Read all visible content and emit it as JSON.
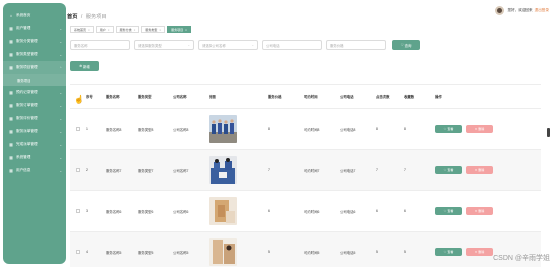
{
  "sidebar": {
    "items": [
      {
        "label": "系统首页",
        "icon": "home-icon"
      },
      {
        "label": "用户管理",
        "icon": "grid-icon",
        "expandable": true
      },
      {
        "label": "服务分类管理",
        "icon": "grid-icon",
        "expandable": true
      },
      {
        "label": "服务类型管理",
        "icon": "grid-icon",
        "expandable": true
      },
      {
        "label": "服务项目管理",
        "icon": "grid-icon",
        "expandable": true,
        "active": true,
        "sub": [
          "服务项目"
        ]
      },
      {
        "label": "预约记录管理",
        "icon": "grid-icon",
        "expandable": true
      },
      {
        "label": "服务订单管理",
        "icon": "grid-icon",
        "expandable": true
      },
      {
        "label": "服务评价管理",
        "icon": "grid-icon",
        "expandable": true
      },
      {
        "label": "服务派单管理",
        "icon": "grid-icon",
        "expandable": true
      },
      {
        "label": "完成派单管理",
        "icon": "grid-icon",
        "expandable": true
      },
      {
        "label": "系统管理",
        "icon": "grid-icon",
        "expandable": true
      },
      {
        "label": "用户信息",
        "icon": "grid-icon",
        "expandable": true
      }
    ]
  },
  "header": {
    "breadcrumb_home": "首页",
    "breadcrumb_sep": "/",
    "breadcrumb_current": "服务项目",
    "user_text": "您好，欢迎回来",
    "logout": "退出登录"
  },
  "tags": [
    "系统首页",
    "用户",
    "服务分类",
    "服务类型",
    "服务项目"
  ],
  "filters": {
    "name_placeholder": "服务名称",
    "type_placeholder": "请选择服务类型",
    "company_placeholder": "请选择公司名称",
    "phone_placeholder": "公司电话",
    "quote_placeholder": "服务价格",
    "search_label": "查询"
  },
  "toolbar": {
    "add_label": "新增"
  },
  "table": {
    "columns": [
      "序号",
      "服务名称",
      "服务类型",
      "公司名称",
      "封面",
      "服务价格",
      "可约时间",
      "公司电话",
      "点击次数",
      "收藏数",
      "操作"
    ],
    "rows": [
      {
        "index": "1",
        "name": "服务名称8",
        "type": "服务类型8",
        "company": "公司名称8",
        "price": "8",
        "time": "可约时间8",
        "phone": "公司电话8",
        "clicks": "8",
        "favorites": "8"
      },
      {
        "index": "2",
        "name": "服务名称7",
        "type": "服务类型7",
        "company": "公司名称7",
        "price": "7",
        "time": "可约时间7",
        "phone": "公司电话7",
        "clicks": "7",
        "favorites": "7"
      },
      {
        "index": "3",
        "name": "服务名称6",
        "type": "服务类型6",
        "company": "公司名称6",
        "price": "6",
        "time": "可约时间6",
        "phone": "公司电话6",
        "clicks": "6",
        "favorites": "6"
      },
      {
        "index": "4",
        "name": "服务名称5",
        "type": "服务类型5",
        "company": "公司名称5",
        "price": "5",
        "time": "可约时间5",
        "phone": "公司电话5",
        "clicks": "5",
        "favorites": "5"
      }
    ],
    "view_label": "查看",
    "delete_label": "删除"
  },
  "watermark": "CSDN @辛雨学姐",
  "colors": {
    "primary": "#5fa38c",
    "danger": "#f4a2a2",
    "sidebar": "#5fa38c"
  }
}
